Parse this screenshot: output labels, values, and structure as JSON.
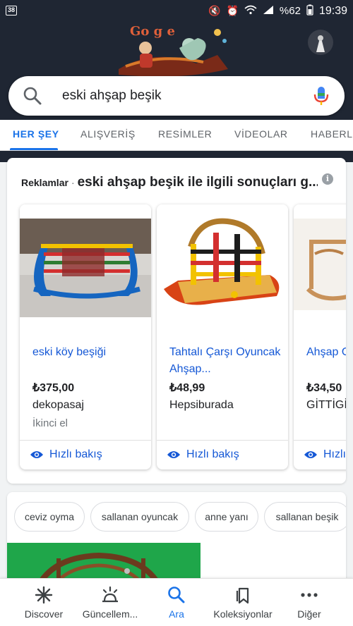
{
  "status_bar": {
    "notification_count": "38",
    "battery": "%62",
    "time": "19:39"
  },
  "search": {
    "query": "eski ahşap beşik"
  },
  "tabs": [
    {
      "label": "HER ŞEY",
      "active": true
    },
    {
      "label": "ALIŞVERİŞ",
      "active": false
    },
    {
      "label": "RESİMLER",
      "active": false
    },
    {
      "label": "VİDEOLAR",
      "active": false
    },
    {
      "label": "HABERLER",
      "active": false
    }
  ],
  "ads": {
    "label": "Reklamlar",
    "separator": "·",
    "title": "eski ahşap beşik ile ilgili sonuçları g...",
    "info_icon": "info-icon",
    "products": [
      {
        "name": "eski köy beşiği",
        "price": "₺375,00",
        "store": "dekopasaj",
        "condition": "İkinci el",
        "quick_view": "Hızlı bakış"
      },
      {
        "name": "Tahtalı Çarşı Oyuncak Ahşap...",
        "price": "₺48,99",
        "store": "Hepsiburada",
        "condition": "",
        "quick_view": "Hızlı bakış"
      },
      {
        "name": "Ahşap Oy Beşik",
        "price": "₺34,50",
        "store": "GİTTİGİD",
        "condition": "",
        "quick_view": "Hızlı bak"
      }
    ]
  },
  "chips": [
    "ceviz oyma",
    "sallanan oyuncak",
    "anne yanı",
    "sallanan beşik"
  ],
  "bottom_nav": [
    {
      "label": "Discover",
      "icon": "asterisk-icon",
      "active": false
    },
    {
      "label": "Güncellem...",
      "icon": "updates-icon",
      "active": false
    },
    {
      "label": "Ara",
      "icon": "search-icon",
      "active": true
    },
    {
      "label": "Koleksiyonlar",
      "icon": "bookmark-icon",
      "active": false
    },
    {
      "label": "Diğer",
      "icon": "more-icon",
      "active": false
    }
  ],
  "colors": {
    "accent": "#1a73e8",
    "link": "#1558d6",
    "header_bg": "#1f2633"
  }
}
